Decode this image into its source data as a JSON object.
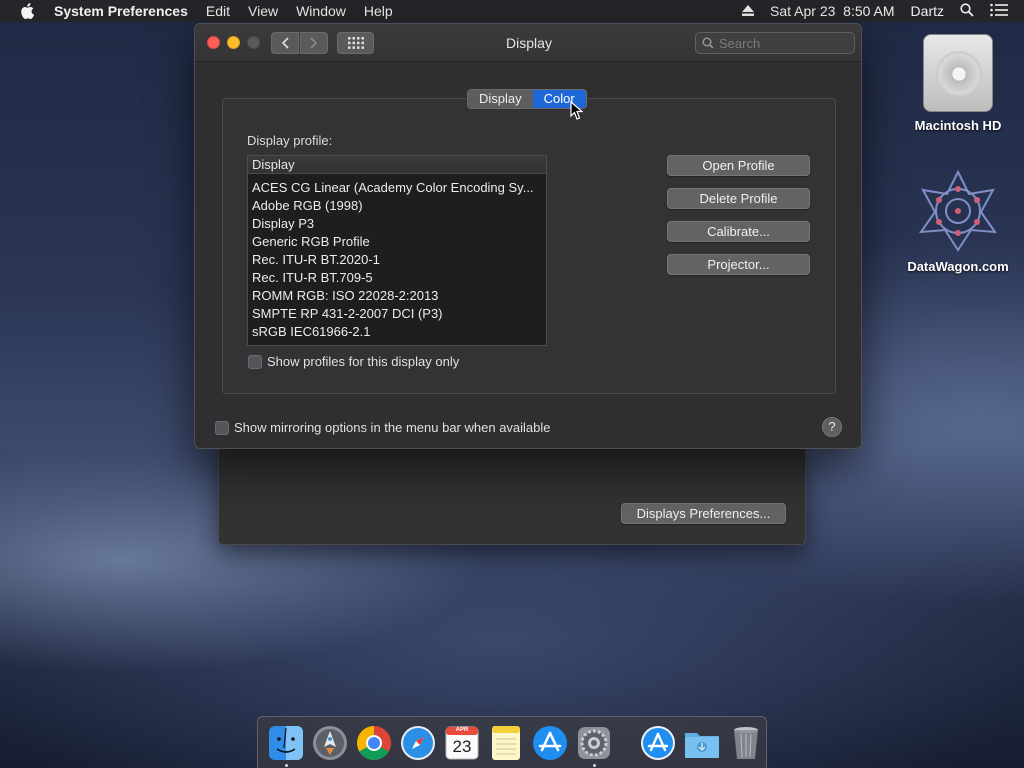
{
  "menubar": {
    "app_name": "System Preferences",
    "menus": [
      "Edit",
      "View",
      "Window",
      "Help"
    ],
    "clock": "Sat Apr 23  8:50 AM",
    "user": "Dartz"
  },
  "desktop": {
    "icons": [
      {
        "label": "Macintosh HD",
        "icon": "hard-drive-icon"
      },
      {
        "label": "DataWagon.com",
        "icon": "datawagon-logo-icon"
      }
    ]
  },
  "window": {
    "title": "Display",
    "search_placeholder": "Search",
    "tabs": [
      {
        "label": "Display",
        "active": false
      },
      {
        "label": "Color",
        "active": true
      }
    ],
    "profile_label": "Display profile:",
    "list_header": "Display",
    "profiles": [
      "ACES CG Linear (Academy Color Encoding Sy...",
      "Adobe RGB (1998)",
      "Display P3",
      "Generic RGB Profile",
      "Rec. ITU-R BT.2020-1",
      "Rec. ITU-R BT.709-5",
      "ROMM RGB: ISO 22028-2:2013",
      "SMPTE RP 431-2-2007 DCI (P3)",
      "sRGB IEC61966-2.1"
    ],
    "buttons": {
      "open": "Open Profile",
      "delete": "Delete Profile",
      "calibrate": "Calibrate...",
      "projector": "Projector..."
    },
    "show_profiles_checkbox": "Show profiles for this display only",
    "mirroring_checkbox": "Show mirroring options in the menu bar when available",
    "help": "?"
  },
  "background_window": {
    "button": "Displays Preferences..."
  },
  "dock": {
    "items": [
      "finder-icon",
      "launchpad-icon",
      "chrome-icon",
      "safari-icon",
      "calendar-icon",
      "notes-icon",
      "app-store-icon",
      "system-preferences-icon"
    ],
    "calendar_month": "APR",
    "calendar_day": "23",
    "right_items": [
      "app-store-downloads-icon",
      "downloads-folder-icon",
      "trash-icon"
    ]
  },
  "colors": {
    "accent": "#1f67d6",
    "close": "#ff5f57",
    "minimize": "#febc2e"
  }
}
